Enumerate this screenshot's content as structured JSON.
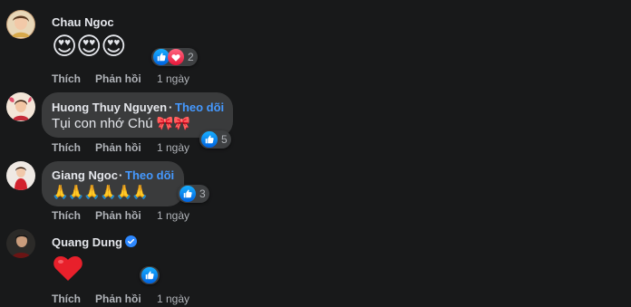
{
  "labels": {
    "like": "Thích",
    "reply": "Phản hồi",
    "follow": "Theo dõi",
    "dot": "·"
  },
  "comments": [
    {
      "author": "Chau Ngoc",
      "text": "😍😍😍",
      "time": "1 ngày",
      "reaction_count": "2",
      "reactions": [
        "like-icon",
        "heart-icon"
      ]
    },
    {
      "author": "Huong Thuy Nguyen",
      "text": "Tụi con nhớ Chú 🎀🎀",
      "time": "1 ngày",
      "reaction_count": "5",
      "reactions": [
        "like-icon"
      ]
    },
    {
      "author": "Giang Ngoc",
      "text": "🙏🙏🙏🙏🙏🙏",
      "time": "1 ngày",
      "reaction_count": "3",
      "reactions": [
        "like-icon"
      ]
    },
    {
      "author": "Quang Dung",
      "verified": true,
      "text": "❤",
      "time": "1 ngày",
      "reaction_count": "",
      "reactions": [
        "like-icon"
      ]
    }
  ],
  "colors": {
    "background": "#18191a",
    "bubble": "#3a3b3c",
    "primary_text": "#e4e6eb",
    "secondary_text": "#b0b3b8",
    "link_blue": "#4599ff",
    "like_blue": "#1877f2",
    "heart_red": "#f33e58"
  }
}
